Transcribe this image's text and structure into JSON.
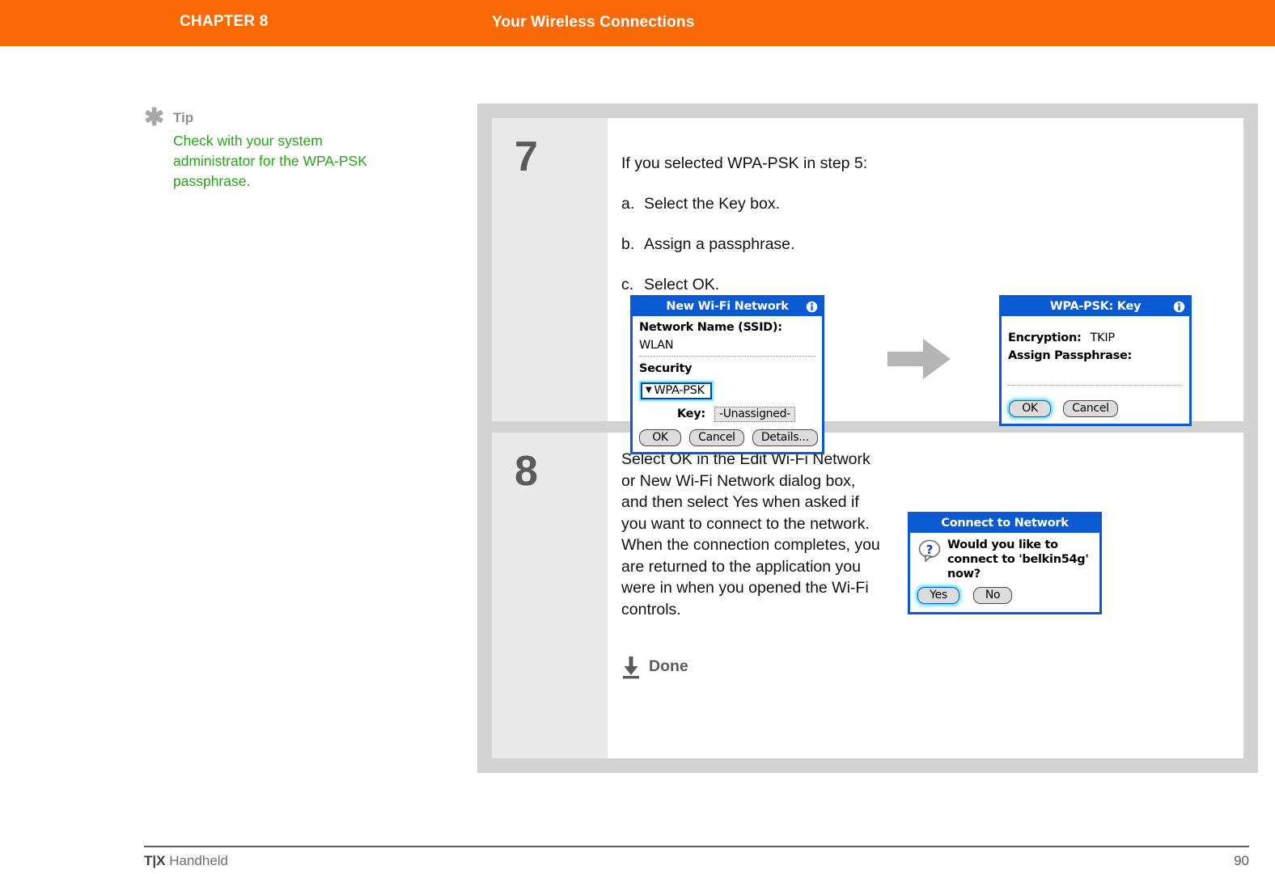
{
  "header": {
    "chapter": "CHAPTER 8",
    "title": "Your Wireless Connections",
    "accent_color": "#F96A07"
  },
  "tip": {
    "icon": "asterisk-icon",
    "label": "Tip",
    "body": "Check with your system administrator for the WPA-PSK passphrase.",
    "text_color": "#26A616",
    "label_color": "#8F8F8F"
  },
  "steps": [
    {
      "number": "7",
      "lead": "If you selected WPA-PSK in step 5:",
      "items": [
        {
          "mark": "a.",
          "text": "Select the Key box."
        },
        {
          "mark": "b.",
          "text": "Assign a passphrase."
        },
        {
          "mark": "c.",
          "text": "Select OK."
        }
      ]
    },
    {
      "number": "8",
      "text": "Select OK in the Edit Wi-Fi Network or New Wi-Fi Network dialog box, and then select Yes when asked if you want to connect to the network. When the connection completes, you are returned to the application you were in when you opened the Wi-Fi controls.",
      "done_label": "Done",
      "done_icon": "down-arrow-to-line-icon"
    }
  ],
  "flow_arrow": {
    "icon": "right-arrow-icon",
    "color": "#B5B5B5"
  },
  "dialogs": {
    "new_wifi_network": {
      "title": "New Wi-Fi Network",
      "info_icon": "info-icon",
      "ssid_label": "Network Name (SSID):",
      "ssid_value": "WLAN",
      "security_label": "Security",
      "security_value": "WPA-PSK",
      "security_selected": true,
      "key_label": "Key:",
      "key_value": "-Unassigned-",
      "buttons": [
        {
          "label": "OK",
          "selected": false
        },
        {
          "label": "Cancel",
          "selected": false
        },
        {
          "label": "Details...",
          "selected": false
        }
      ],
      "title_bar_color": "#0A5BD3"
    },
    "wpa_psk_key": {
      "title": "WPA-PSK: Key",
      "info_icon": "info-icon",
      "encryption_label": "Encryption:",
      "encryption_value": "TKIP",
      "passphrase_label": "Assign Passphrase:",
      "passphrase_value": "",
      "buttons": [
        {
          "label": "OK",
          "selected": true
        },
        {
          "label": "Cancel",
          "selected": false
        }
      ],
      "title_bar_color": "#0A5BD3"
    },
    "connect_to_network": {
      "title": "Connect to Network",
      "icon": "question-bubble-icon",
      "message": "Would you like to connect to 'belkin54g' now?",
      "buttons": [
        {
          "label": "Yes",
          "selected": true
        },
        {
          "label": "No",
          "selected": false
        }
      ],
      "title_bar_color": "#0A5BD3"
    }
  },
  "footer": {
    "product_bold": "T|X",
    "product_light": "Handheld",
    "page_number": "90"
  }
}
